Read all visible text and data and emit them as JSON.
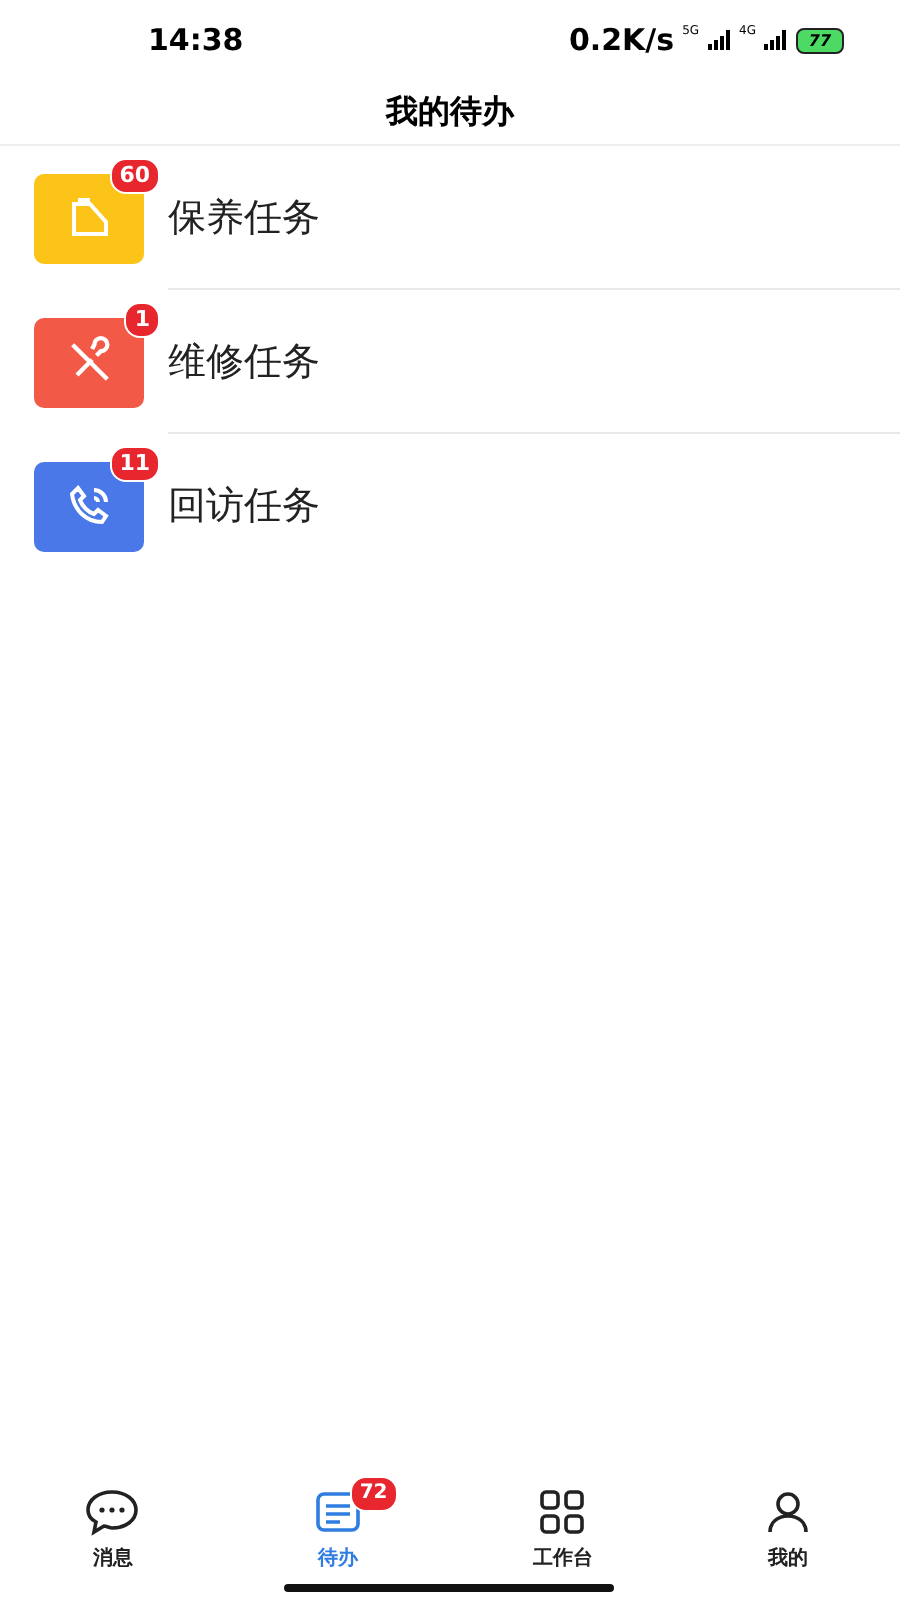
{
  "status_bar": {
    "time": "14:38",
    "speed": "0.2K/s",
    "network_1": "5G",
    "network_2": "4G",
    "battery": "77"
  },
  "title": "我的待办",
  "tasks": [
    {
      "kind": "maintenance",
      "label": "保养任务",
      "count": "60",
      "color": "#fcc419"
    },
    {
      "kind": "repair",
      "label": "维修任务",
      "count": "1",
      "color": "#f25a47"
    },
    {
      "kind": "callback",
      "label": "回访任务",
      "count": "11",
      "color": "#4a78e8"
    }
  ],
  "tabs": [
    {
      "kind": "message",
      "label": "消息",
      "selected": false
    },
    {
      "kind": "todo",
      "label": "待办",
      "selected": true,
      "count": "72"
    },
    {
      "kind": "workbench",
      "label": "工作台",
      "selected": false
    },
    {
      "kind": "profile",
      "label": "我的",
      "selected": false
    }
  ]
}
